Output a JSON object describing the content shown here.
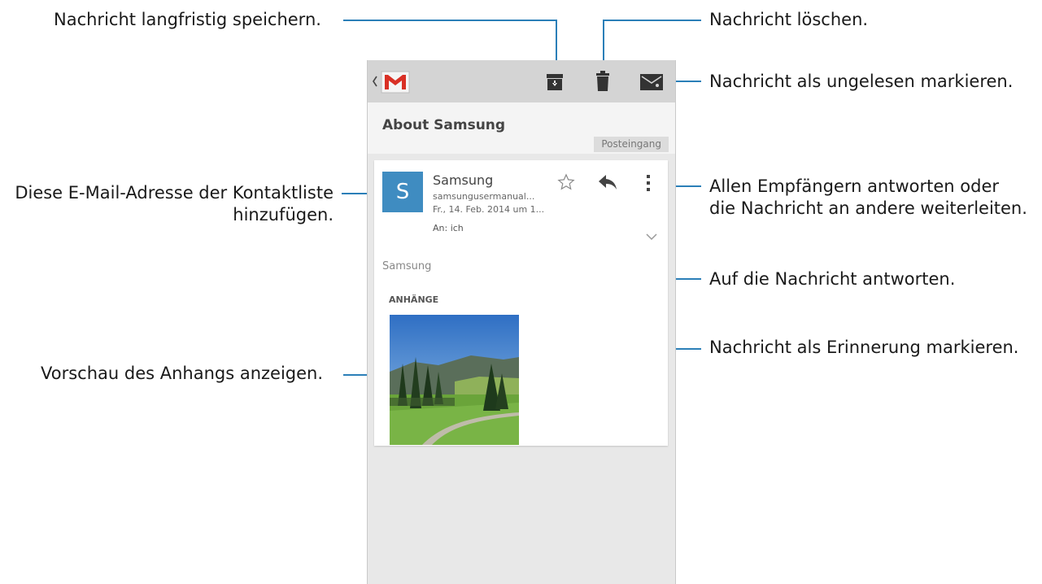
{
  "callouts": {
    "archive": "Nachricht langfristig speichern.",
    "delete": "Nachricht löschen.",
    "mark_unread": "Nachricht als ungelesen markieren.",
    "reply_all_line1": "Allen Empfängern antworten oder",
    "reply_all_line2": "die Nachricht an andere weiterleiten.",
    "add_contact_line1": "Diese E-Mail-Adresse der Kontaktliste",
    "add_contact_line2": "hinzufügen.",
    "reply": "Auf die Nachricht antworten.",
    "star": "Nachricht als Erinnerung markieren.",
    "preview": "Vorschau des Anhangs anzeigen."
  },
  "message": {
    "subject": "About Samsung",
    "label": "Posteingang",
    "avatar_letter": "S",
    "sender": "Samsung",
    "address": "samsungusermanual...",
    "date": "Fr., 14. Feb. 2014 um 1...",
    "to": "An: ich",
    "body": "Samsung",
    "attachments_heading": "ANHÄNGE"
  },
  "icons": {
    "back": "back-chevron-icon",
    "app": "gmail-icon",
    "archive": "archive-icon",
    "delete": "trash-icon",
    "mark_unread": "envelope-icon",
    "star": "star-icon",
    "reply": "reply-icon",
    "overflow": "overflow-menu-icon",
    "expand": "chevron-down-icon"
  },
  "colors": {
    "leader": "#2b7fb8",
    "action_bar": "#d4d4d4",
    "avatar": "#3f8cc1",
    "gmail_red": "#d93025"
  }
}
